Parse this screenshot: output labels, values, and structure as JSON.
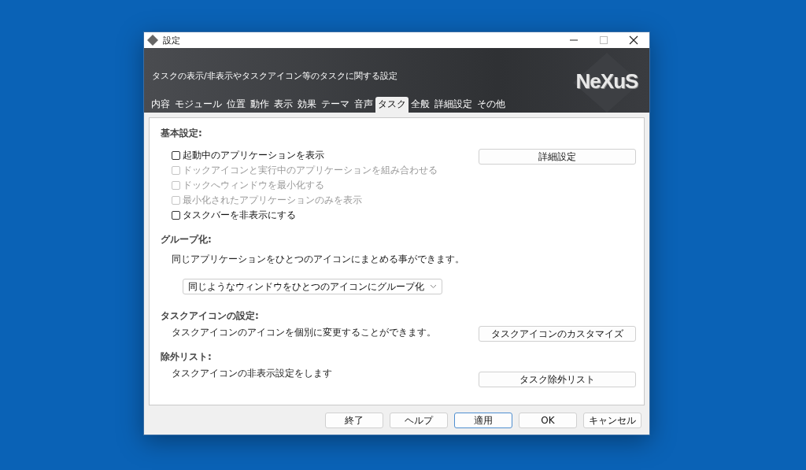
{
  "window": {
    "title": "設定"
  },
  "banner": {
    "description": "タスクの表示/非表示やタスクアイコン等のタスクに関する設定",
    "logo": "NeXuS"
  },
  "tabs": [
    {
      "label": "内容",
      "selected": false
    },
    {
      "label": "モジュール",
      "selected": false
    },
    {
      "label": "位置",
      "selected": false
    },
    {
      "label": "動作",
      "selected": false
    },
    {
      "label": "表示",
      "selected": false
    },
    {
      "label": "効果",
      "selected": false
    },
    {
      "label": "テーマ",
      "selected": false
    },
    {
      "label": "音声",
      "selected": false
    },
    {
      "label": "タスク",
      "selected": true
    },
    {
      "label": "全般",
      "selected": false
    },
    {
      "label": "詳細設定",
      "selected": false
    },
    {
      "label": "その他",
      "selected": false
    }
  ],
  "basic": {
    "heading": "基本設定:",
    "button": "詳細設定",
    "checkboxes": [
      {
        "label": "起動中のアプリケーションを表示",
        "checked": false,
        "disabled": false
      },
      {
        "label": "ドックアイコンと実行中のアプリケーションを組み合わせる",
        "checked": false,
        "disabled": true
      },
      {
        "label": "ドックへウィンドウを最小化する",
        "checked": false,
        "disabled": true
      },
      {
        "label": "最小化されたアプリケーションのみを表示",
        "checked": false,
        "disabled": true
      },
      {
        "label": "タスクバーを非表示にする",
        "checked": false,
        "disabled": false
      }
    ]
  },
  "grouping": {
    "heading": "グループ化:",
    "description": "同じアプリケーションをひとつのアイコンにまとめる事ができます。",
    "dropdown": {
      "value": "同じようなウィンドウをひとつのアイコンにグループ化"
    }
  },
  "task_icon": {
    "heading": "タスクアイコンの設定:",
    "description": "タスクアイコンのアイコンを個別に変更することができます。",
    "button": "タスクアイコンのカスタマイズ"
  },
  "exclusion": {
    "heading": "除外リスト:",
    "description": "タスクアイコンの非表示設定をします",
    "button": "タスク除外リスト"
  },
  "footer_buttons": [
    {
      "label": "終了",
      "default": false
    },
    {
      "label": "ヘルプ",
      "default": false
    },
    {
      "label": "適用",
      "default": true
    },
    {
      "label": "OK",
      "default": false
    },
    {
      "label": "キャンセル",
      "default": false
    }
  ]
}
